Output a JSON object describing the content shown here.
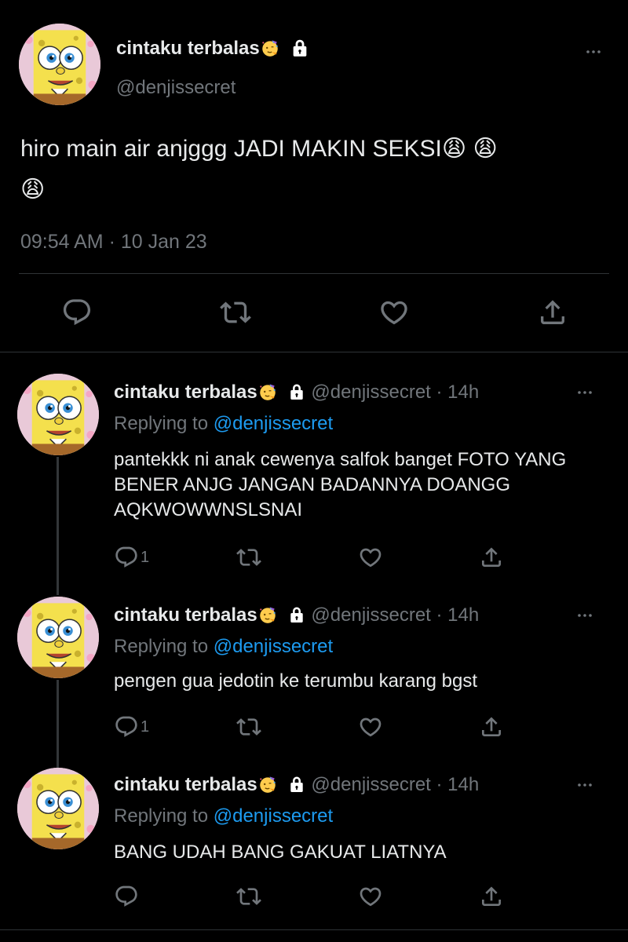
{
  "main_tweet": {
    "display_name": "cintaku terbalas",
    "emoji": "🥳",
    "handle": "@denjissecret",
    "text_line1": "hiro main air anjggg JADI MAKIN SEKSI😩 😩",
    "text_line2": "😩",
    "timestamp": "09:54 AM · 10 Jan 23",
    "icons": [
      "reply-icon",
      "retweet-icon",
      "like-icon",
      "share-icon"
    ]
  },
  "replies": [
    {
      "display_name": "cintaku terbalas",
      "handle_time": "@denjissecret · 14h",
      "replying_prefix": "Replying to",
      "replying_handle": "@denjissecret",
      "text": "pantekkk ni anak cewenya salfok banget FOTO YANG BENER ANJG JANGAN BADANNYA DOANGG AQKWOWWNSLSNAI",
      "reply_count": "1"
    },
    {
      "display_name": "cintaku terbalas",
      "handle_time": "@denjissecret · 14h",
      "replying_prefix": "Replying to",
      "replying_handle": "@denjissecret",
      "text": "pengen gua jedotin ke terumbu karang bgst",
      "reply_count": "1"
    },
    {
      "display_name": "cintaku terbalas",
      "handle_time": "@denjissecret · 14h",
      "replying_prefix": "Replying to",
      "replying_handle": "@denjissecret",
      "text": "BANG UDAH BANG GAKUAT LIATNYA",
      "reply_count": ""
    }
  ],
  "colors": {
    "background": "#000000",
    "text": "#e7e9ea",
    "muted": "#71767b",
    "link": "#1d9bf0",
    "divider": "#2f3336"
  }
}
